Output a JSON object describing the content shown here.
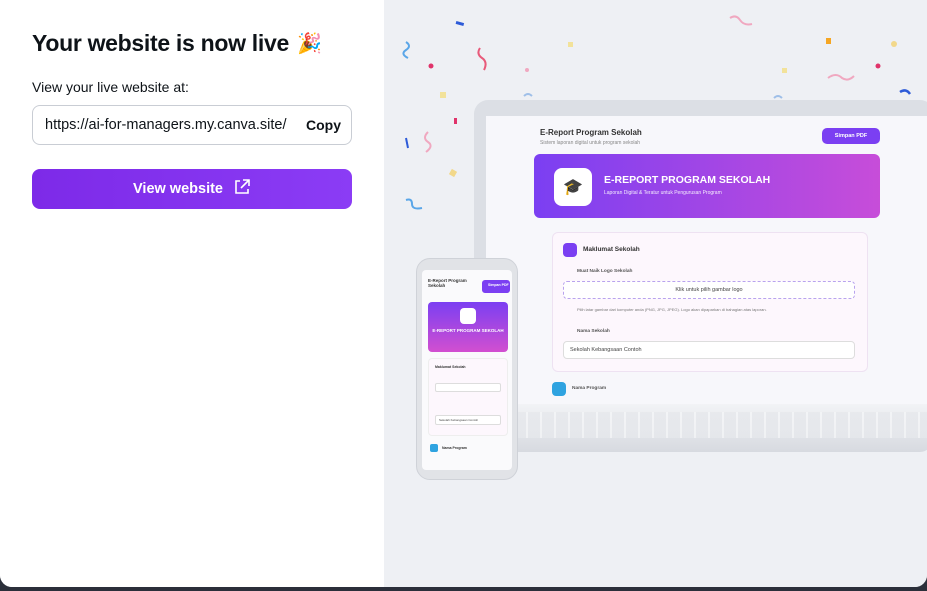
{
  "modal": {
    "title": "Your website is now live",
    "title_emoji": "🎉",
    "live_label": "View your live website at:",
    "url": "https://ai-for-managers.my.canva.site/",
    "copy_label": "Copy",
    "view_button_label": "View website"
  },
  "preview": {
    "laptop": {
      "app_title": "E-Report Program Sekolah",
      "app_subtitle": "Sistem laporan digital untuk program sekolah",
      "save_pdf": "Simpan PDF",
      "banner_title": "E-REPORT PROGRAM SEKOLAH",
      "banner_subtitle": "Laporan Digital & Teratur untuk Pengurusan Program",
      "section_title": "Maklumat Sekolah",
      "logo_label": "Muat Naik Logo Sekolah",
      "logo_button": "Klik untuk pilih gambar logo",
      "logo_hint": "Pilih latar gambar dari komputer anda (PNG, JPG, JPEG). Logo akan dipaparkan di bahagian atas laporan.",
      "school_label": "Nama Sekolah",
      "school_value": "Sekolah Kebangsaan Contoh",
      "program_label": "Nama Program"
    },
    "phone": {
      "app_title": "E-Report Program Sekolah",
      "save_pdf": "Simpan PDF",
      "banner_title": "E-REPORT PROGRAM SEKOLAH",
      "section_title": "Maklumat Sekolah",
      "school_value": "Sekolah Kebangsaan Contoh",
      "program_label": "Nama Program"
    }
  },
  "colors": {
    "accent": "#7d2ae8",
    "banner_start": "#7b3ff2",
    "banner_end": "#c74dd9"
  }
}
